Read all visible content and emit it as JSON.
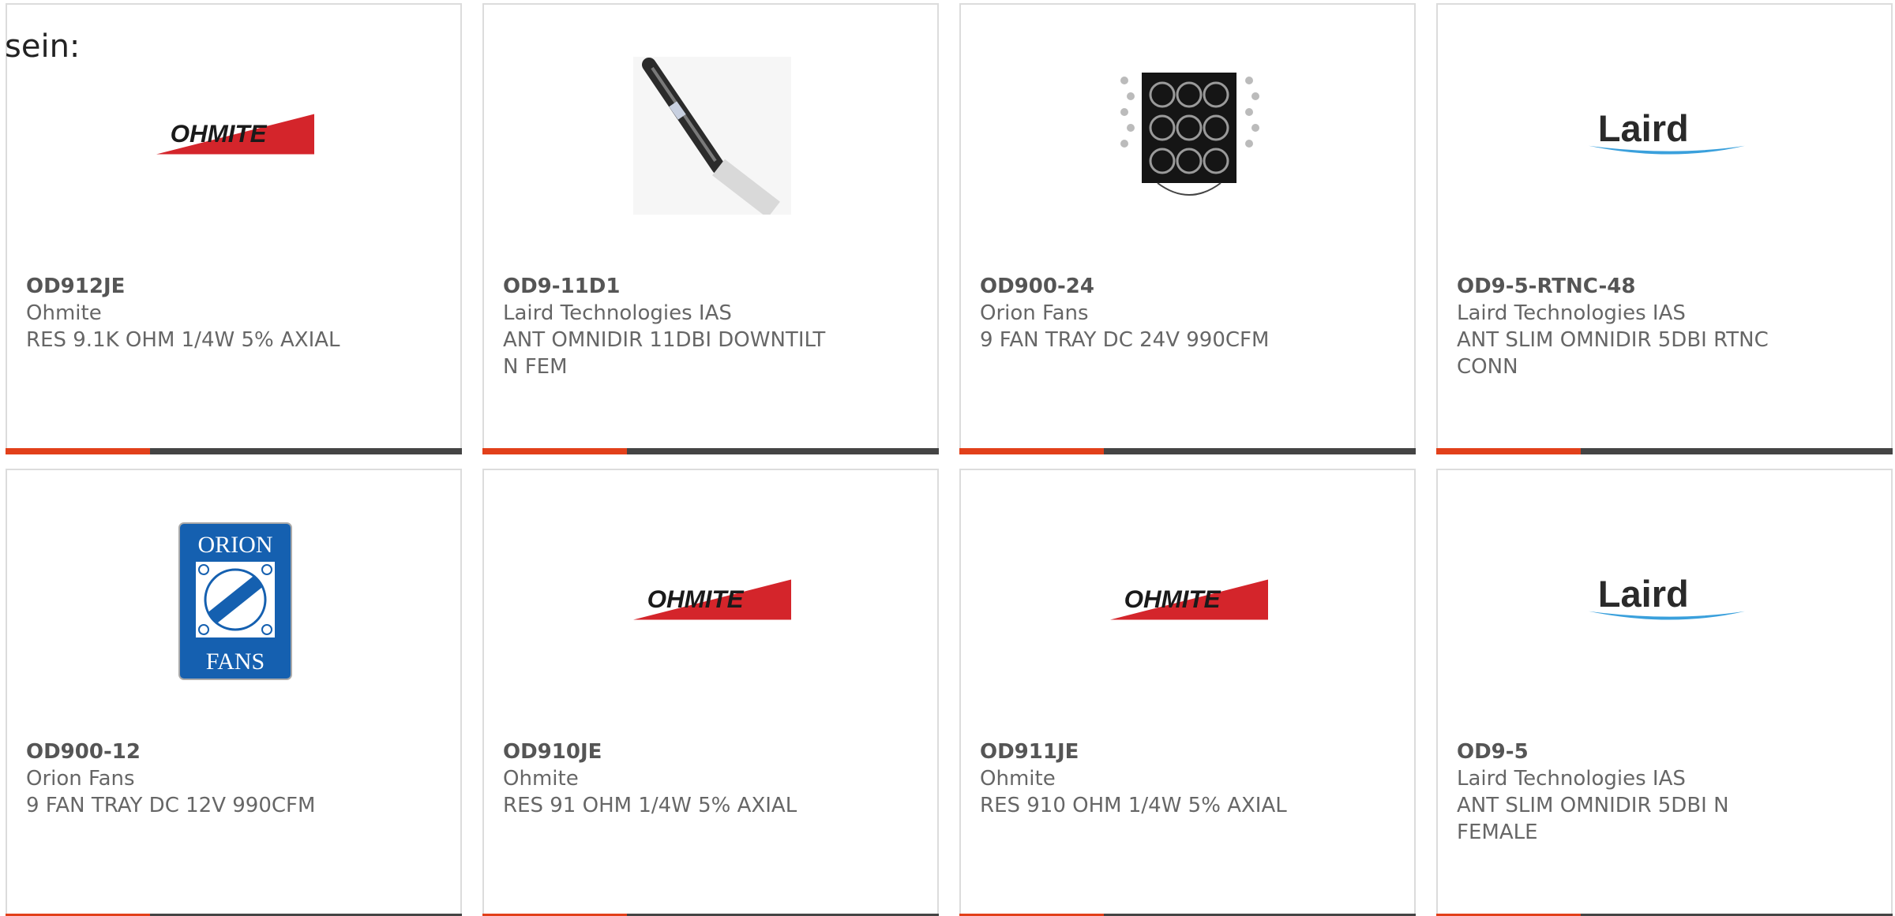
{
  "intro_text": "sein:",
  "colors": {
    "accent": "#e2401a",
    "bar_dark": "#444444",
    "ohmite_red": "#d4252b",
    "laird_blue": "#3aa0dc",
    "orion_blue": "#1560b0"
  },
  "products": [
    {
      "part": "OD912JE",
      "manufacturer": "Ohmite",
      "description": "RES 9.1K OHM 1/4W 5% AXIAL",
      "image": "ohmite-logo",
      "logo_text": "OHMITE"
    },
    {
      "part": "OD9-11D1",
      "manufacturer": "Laird Technologies IAS",
      "description": "ANT OMNIDIR 11DBI DOWNTILT N FEM",
      "image": "antenna-photo"
    },
    {
      "part": "OD900-24",
      "manufacturer": "Orion Fans",
      "description": "9 FAN TRAY DC 24V 990CFM",
      "image": "fan-tray-photo"
    },
    {
      "part": "OD9-5-RTNC-48",
      "manufacturer": "Laird Technologies IAS",
      "description": "ANT SLIM OMNIDIR 5DBI RTNC CONN",
      "image": "laird-logo",
      "logo_text": "Laird"
    },
    {
      "part": "OD900-12",
      "manufacturer": "Orion Fans",
      "description": "9 FAN TRAY DC 12V 990CFM",
      "image": "orion-fans-logo",
      "logo_text_top": "ORION",
      "logo_text_bottom": "FANS"
    },
    {
      "part": "OD910JE",
      "manufacturer": "Ohmite",
      "description": "RES 91 OHM 1/4W 5% AXIAL",
      "image": "ohmite-logo",
      "logo_text": "OHMITE"
    },
    {
      "part": "OD911JE",
      "manufacturer": "Ohmite",
      "description": "RES 910 OHM 1/4W 5% AXIAL",
      "image": "ohmite-logo",
      "logo_text": "OHMITE"
    },
    {
      "part": "OD9-5",
      "manufacturer": "Laird Technologies IAS",
      "description": "ANT SLIM OMNIDIR 5DBI N FEMALE",
      "image": "laird-logo",
      "logo_text": "Laird"
    }
  ]
}
